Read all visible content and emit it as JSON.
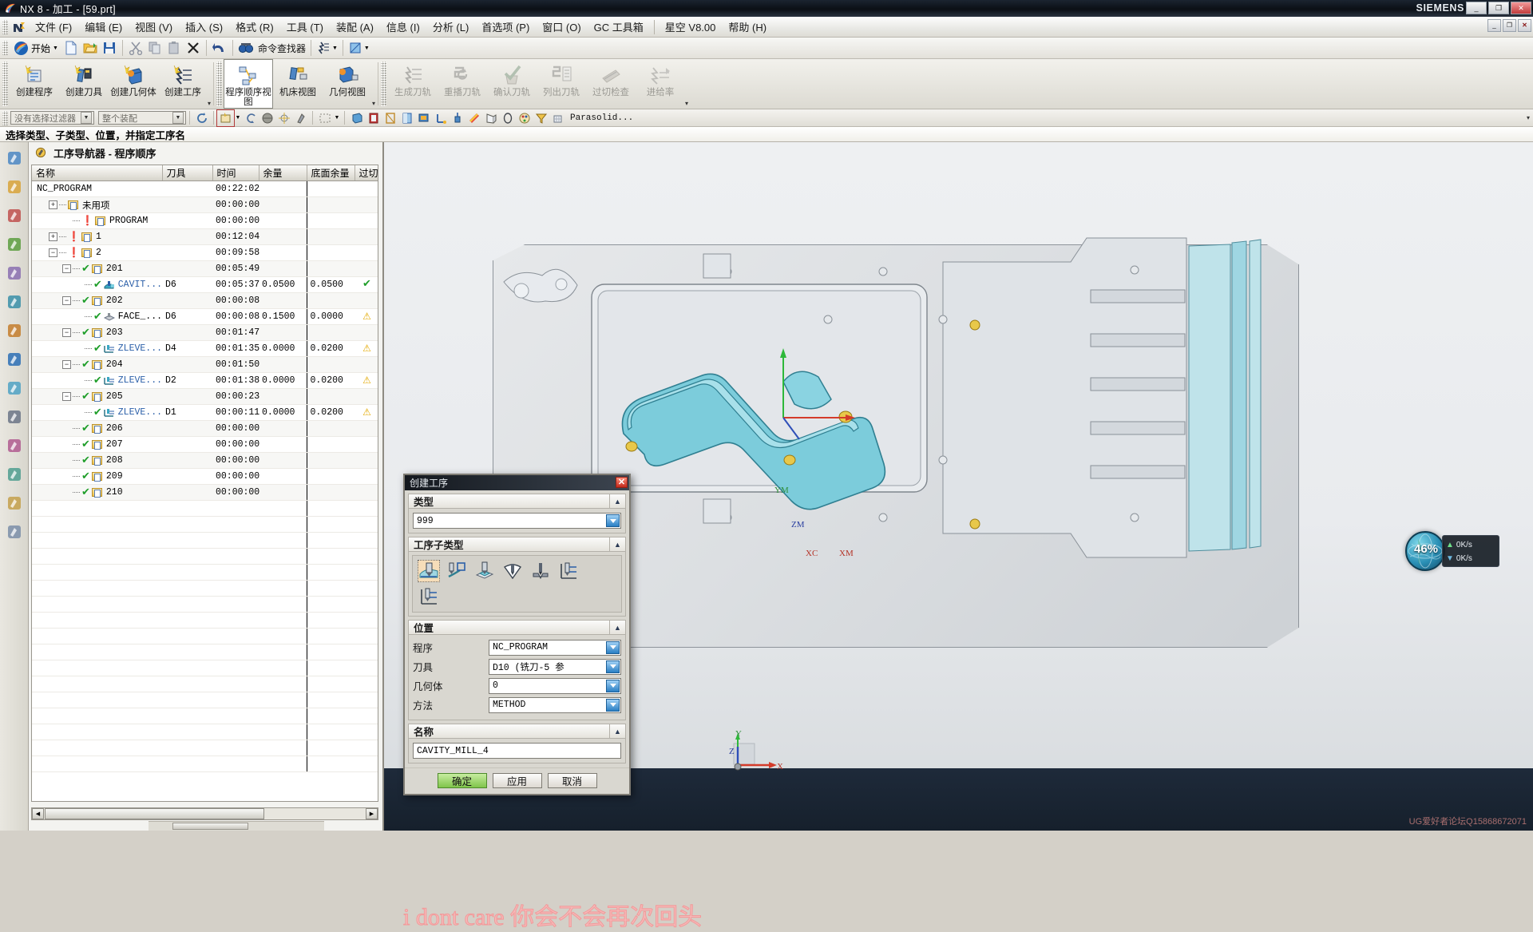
{
  "window": {
    "title": "NX 8 - 加工 - [59.prt]",
    "brand": "SIEMENS",
    "app_icon": "nx-logo-icon",
    "buttons": {
      "minimize": "_",
      "maximize": "❐",
      "close": "✕"
    },
    "inner_buttons": {
      "minimize": "_",
      "restore": "❐",
      "close": "✕"
    }
  },
  "menubar": {
    "items": [
      {
        "label": "文件 (F)"
      },
      {
        "label": "编辑 (E)"
      },
      {
        "label": "视图 (V)"
      },
      {
        "label": "插入 (S)"
      },
      {
        "label": "格式 (R)"
      },
      {
        "label": "工具 (T)"
      },
      {
        "label": "装配 (A)"
      },
      {
        "label": "信息 (I)"
      },
      {
        "label": "分析 (L)"
      },
      {
        "label": "首选项 (P)"
      },
      {
        "label": "窗口 (O)"
      },
      {
        "label": "GC 工具箱"
      }
    ],
    "items_right": [
      {
        "label": "星空 V8.00"
      },
      {
        "label": "帮助 (H)"
      }
    ]
  },
  "toolbar_standard": {
    "start_label": "开始",
    "command_finder_label": "命令查找器",
    "buttons": [
      {
        "name": "new-file-icon"
      },
      {
        "name": "open-file-icon"
      },
      {
        "name": "save-icon"
      },
      {
        "name": "cut-icon"
      },
      {
        "name": "copy-icon"
      },
      {
        "name": "paste-icon"
      },
      {
        "name": "delete-icon"
      },
      {
        "name": "undo-icon"
      }
    ]
  },
  "ribbon": {
    "groups": [
      {
        "name": "insert-group",
        "buttons": [
          {
            "label": "创建程序",
            "icon": "create-program-icon",
            "state": "normal"
          },
          {
            "label": "创建刀具",
            "icon": "create-tool-icon",
            "state": "normal"
          },
          {
            "label": "创建几何体",
            "icon": "create-geometry-icon",
            "state": "normal"
          },
          {
            "label": "创建工序",
            "icon": "create-operation-icon",
            "state": "normal"
          }
        ]
      },
      {
        "name": "navigator-view-group",
        "buttons": [
          {
            "label": "程序顺序视图",
            "icon": "program-order-view-icon",
            "state": "selected"
          },
          {
            "label": "机床视图",
            "icon": "machine-tool-view-icon",
            "state": "normal"
          },
          {
            "label": "几何视图",
            "icon": "geometry-view-icon",
            "state": "normal"
          }
        ]
      },
      {
        "name": "operation-group",
        "buttons": [
          {
            "label": "生成刀轨",
            "icon": "generate-toolpath-icon",
            "state": "disabled"
          },
          {
            "label": "重播刀轨",
            "icon": "replay-toolpath-icon",
            "state": "disabled"
          },
          {
            "label": "确认刀轨",
            "icon": "verify-toolpath-icon",
            "state": "disabled"
          },
          {
            "label": "列出刀轨",
            "icon": "list-toolpath-icon",
            "state": "disabled"
          },
          {
            "label": "过切检查",
            "icon": "gouge-check-icon",
            "state": "disabled"
          },
          {
            "label": "进给率",
            "icon": "feedrate-icon",
            "state": "disabled"
          }
        ]
      }
    ]
  },
  "selection_bar": {
    "filter_value": "没有选择过滤器",
    "scope_value": "整个装配",
    "render_style_label": "Parasolid...",
    "icons": [
      "refresh-selection-icon",
      "select-face-icon",
      "curve-rule-icon",
      "solid-body-icon",
      "point-snap-icon",
      "feature-icon",
      "rectangle-select-icon",
      "shaded-icon",
      "wireframe-icon",
      "static-wireframe-icon",
      "studio-icon",
      "layer-icon",
      "wcs-icon",
      "datum-icon",
      "color-icon",
      "section-icon",
      "circle-icon",
      "palette-icon",
      "filter-icon",
      "mesh-icon"
    ]
  },
  "cue_bar": {
    "text": "选择类型、子类型、位置，并指定工序名"
  },
  "resource_bar": {
    "icons": [
      "assembly-navigator-icon",
      "part-navigator-icon",
      "operation-navigator-icon",
      "history-tree-icon",
      "reuse-library-icon",
      "hd3d-icon",
      "roles-icon",
      "web-browser-icon",
      "help-icon",
      "history-icon",
      "process-studio-icon",
      "manufacturing-wizard-icon",
      "palette-bar-icon",
      "layout-icon"
    ]
  },
  "navigator": {
    "header_icon": "operation-navigator-icon",
    "header_title": "工序导航器 - 程序顺序",
    "columns": [
      "名称",
      "刀具",
      "时间",
      "余量",
      "底面余量",
      "过切"
    ],
    "rows": [
      {
        "indent": 0,
        "expander": "",
        "status": "",
        "icon": "",
        "name": "NC_PROGRAM",
        "tool": "",
        "time": "00:22:02",
        "stock": "",
        "floor_stock": "",
        "gouge": "",
        "blue": false
      },
      {
        "indent": 1,
        "expander": "+",
        "status": "",
        "icon": "folder",
        "name": "未用项",
        "tool": "",
        "time": "00:00:00",
        "stock": "",
        "floor_stock": "",
        "gouge": "",
        "blue": false
      },
      {
        "indent": 2,
        "expander": "",
        "status": "warn",
        "icon": "folder",
        "name": "PROGRAM",
        "tool": "",
        "time": "00:00:00",
        "stock": "",
        "floor_stock": "",
        "gouge": "",
        "blue": false
      },
      {
        "indent": 1,
        "expander": "+",
        "status": "warn",
        "icon": "folder",
        "name": "1",
        "tool": "",
        "time": "00:12:04",
        "stock": "",
        "floor_stock": "",
        "gouge": "",
        "blue": false
      },
      {
        "indent": 1,
        "expander": "-",
        "status": "warn",
        "icon": "folder",
        "name": "2",
        "tool": "",
        "time": "00:09:58",
        "stock": "",
        "floor_stock": "",
        "gouge": "",
        "blue": false
      },
      {
        "indent": 2,
        "expander": "-",
        "status": "ok",
        "icon": "folder",
        "name": "201",
        "tool": "",
        "time": "00:05:49",
        "stock": "",
        "floor_stock": "",
        "gouge": "",
        "blue": false
      },
      {
        "indent": 3,
        "expander": "",
        "status": "ok",
        "icon": "cavity",
        "name": "CAVIT...",
        "tool": "D6",
        "time": "00:05:37",
        "stock": "0.0500",
        "floor_stock": "0.0500",
        "gouge": "ok",
        "blue": true
      },
      {
        "indent": 2,
        "expander": "-",
        "status": "ok",
        "icon": "folder",
        "name": "202",
        "tool": "",
        "time": "00:00:08",
        "stock": "",
        "floor_stock": "",
        "gouge": "",
        "blue": false
      },
      {
        "indent": 3,
        "expander": "",
        "status": "ok",
        "icon": "face",
        "name": "FACE_...",
        "tool": "D6",
        "time": "00:00:08",
        "stock": "0.1500",
        "floor_stock": "0.0000",
        "gouge": "warn",
        "blue": false
      },
      {
        "indent": 2,
        "expander": "-",
        "status": "ok",
        "icon": "folder",
        "name": "203",
        "tool": "",
        "time": "00:01:47",
        "stock": "",
        "floor_stock": "",
        "gouge": "",
        "blue": false
      },
      {
        "indent": 3,
        "expander": "",
        "status": "ok",
        "icon": "zlevel",
        "name": "ZLEVE...",
        "tool": "D4",
        "time": "00:01:35",
        "stock": "0.0000",
        "floor_stock": "0.0200",
        "gouge": "warn",
        "blue": true
      },
      {
        "indent": 2,
        "expander": "-",
        "status": "ok",
        "icon": "folder",
        "name": "204",
        "tool": "",
        "time": "00:01:50",
        "stock": "",
        "floor_stock": "",
        "gouge": "",
        "blue": false
      },
      {
        "indent": 3,
        "expander": "",
        "status": "ok",
        "icon": "zlevel",
        "name": "ZLEVE...",
        "tool": "D2",
        "time": "00:01:38",
        "stock": "0.0000",
        "floor_stock": "0.0200",
        "gouge": "warn",
        "blue": true
      },
      {
        "indent": 2,
        "expander": "-",
        "status": "ok",
        "icon": "folder",
        "name": "205",
        "tool": "",
        "time": "00:00:23",
        "stock": "",
        "floor_stock": "",
        "gouge": "",
        "blue": false
      },
      {
        "indent": 3,
        "expander": "",
        "status": "ok",
        "icon": "zlevel",
        "name": "ZLEVE...",
        "tool": "D1",
        "time": "00:00:11",
        "stock": "0.0000",
        "floor_stock": "0.0200",
        "gouge": "warn",
        "blue": true
      },
      {
        "indent": 2,
        "expander": "",
        "status": "ok",
        "icon": "folder",
        "name": "206",
        "tool": "",
        "time": "00:00:00",
        "stock": "",
        "floor_stock": "",
        "gouge": "",
        "blue": false
      },
      {
        "indent": 2,
        "expander": "",
        "status": "ok",
        "icon": "folder",
        "name": "207",
        "tool": "",
        "time": "00:00:00",
        "stock": "",
        "floor_stock": "",
        "gouge": "",
        "blue": false
      },
      {
        "indent": 2,
        "expander": "",
        "status": "ok",
        "icon": "folder",
        "name": "208",
        "tool": "",
        "time": "00:00:00",
        "stock": "",
        "floor_stock": "",
        "gouge": "",
        "blue": false
      },
      {
        "indent": 2,
        "expander": "",
        "status": "ok",
        "icon": "folder",
        "name": "209",
        "tool": "",
        "time": "00:00:00",
        "stock": "",
        "floor_stock": "",
        "gouge": "",
        "blue": false
      },
      {
        "indent": 2,
        "expander": "",
        "status": "ok",
        "icon": "folder",
        "name": "210",
        "tool": "",
        "time": "00:00:00",
        "stock": "",
        "floor_stock": "",
        "gouge": "",
        "blue": false
      }
    ]
  },
  "dialog": {
    "title": "创建工序",
    "close_label": "✕",
    "sections": {
      "type": {
        "label": "类型",
        "value": "999",
        "collapse_icon": "chevron-up-icon"
      },
      "subtype": {
        "label": "工序子类型",
        "collapse_icon": "chevron-up-icon",
        "items": [
          {
            "name": "cavity-mill-icon",
            "selected": true
          },
          {
            "name": "plunge-mill-icon",
            "selected": false
          },
          {
            "name": "corner-rough-icon",
            "selected": false
          },
          {
            "name": "rest-mill-icon",
            "selected": false
          },
          {
            "name": "profile-3d-icon",
            "selected": false
          },
          {
            "name": "zlevel-profile-icon",
            "selected": false
          },
          {
            "name": "zlevel-corner-icon",
            "selected": false
          }
        ]
      },
      "location": {
        "label": "位置",
        "collapse_icon": "chevron-up-icon",
        "fields": [
          {
            "label": "程序",
            "value": "NC_PROGRAM"
          },
          {
            "label": "刀具",
            "value": "D10 (铣刀-5 参"
          },
          {
            "label": "几何体",
            "value": "0"
          },
          {
            "label": "方法",
            "value": "METHOD"
          }
        ]
      },
      "name": {
        "label": "名称",
        "collapse_icon": "chevron-up-icon",
        "value": "CAVITY_MILL_4"
      }
    },
    "buttons": [
      {
        "label": "确定",
        "kind": "ok"
      },
      {
        "label": "应用",
        "kind": "normal"
      },
      {
        "label": "取消",
        "kind": "normal"
      }
    ]
  },
  "graphics": {
    "csys_labels": {
      "ym": "YM",
      "zm": "ZM",
      "xm": "XM",
      "xc": "XC"
    },
    "triad_labels": {
      "x": "X",
      "y": "Y",
      "z": "Z"
    },
    "hud": {
      "percent": "46%",
      "rate_top": "0K/s",
      "rate_bottom": "0K/s"
    }
  },
  "watermarks": {
    "main": "i dont care 你会不会再次回头",
    "corner": "UG爱好者论坛Q15868672071"
  },
  "colors": {
    "accent_blue": "#2b5fa8",
    "ok_green": "#1f9e2a",
    "warn_yellow": "#e3a900",
    "dialog_bg": "#d9d7d0",
    "watermark_pink": "#f6b9b9",
    "part_teal": "#6fc7d8"
  }
}
